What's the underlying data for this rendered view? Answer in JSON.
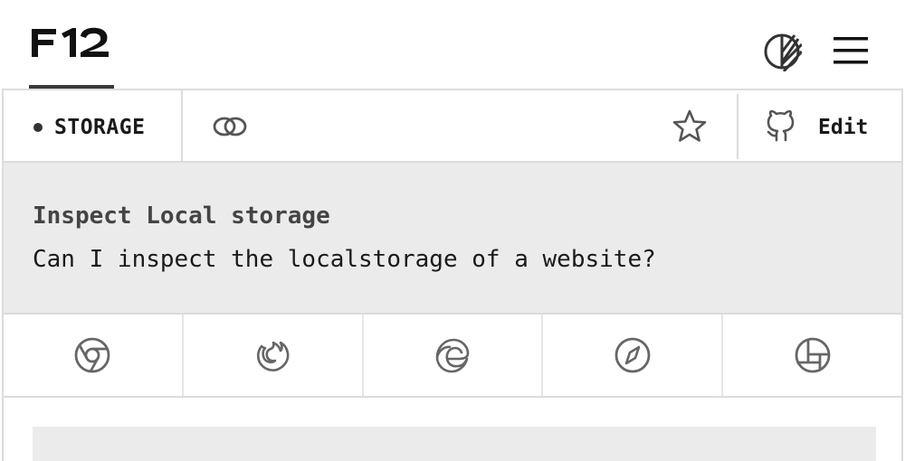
{
  "header": {
    "logo_text": "F12",
    "theme_icon": "theme-toggle-icon",
    "menu_icon": "hamburger-menu-icon"
  },
  "toolbar": {
    "tag_label": "STORAGE",
    "link_icon": "link-icon",
    "star_icon": "star-icon",
    "edit_icon": "github-icon",
    "edit_label": "Edit"
  },
  "question": {
    "title": "Inspect Local storage",
    "text": "Can I inspect the localstorage of a website?"
  },
  "browsers": [
    {
      "icon": "chrome-icon"
    },
    {
      "icon": "firefox-icon"
    },
    {
      "icon": "edge-icon"
    },
    {
      "icon": "safari-icon"
    },
    {
      "icon": "polypane-icon"
    }
  ],
  "colors": {
    "border": "#dcdcdc",
    "panel": "#ebebeb",
    "text": "#1a1a1a",
    "icon": "#555555"
  }
}
